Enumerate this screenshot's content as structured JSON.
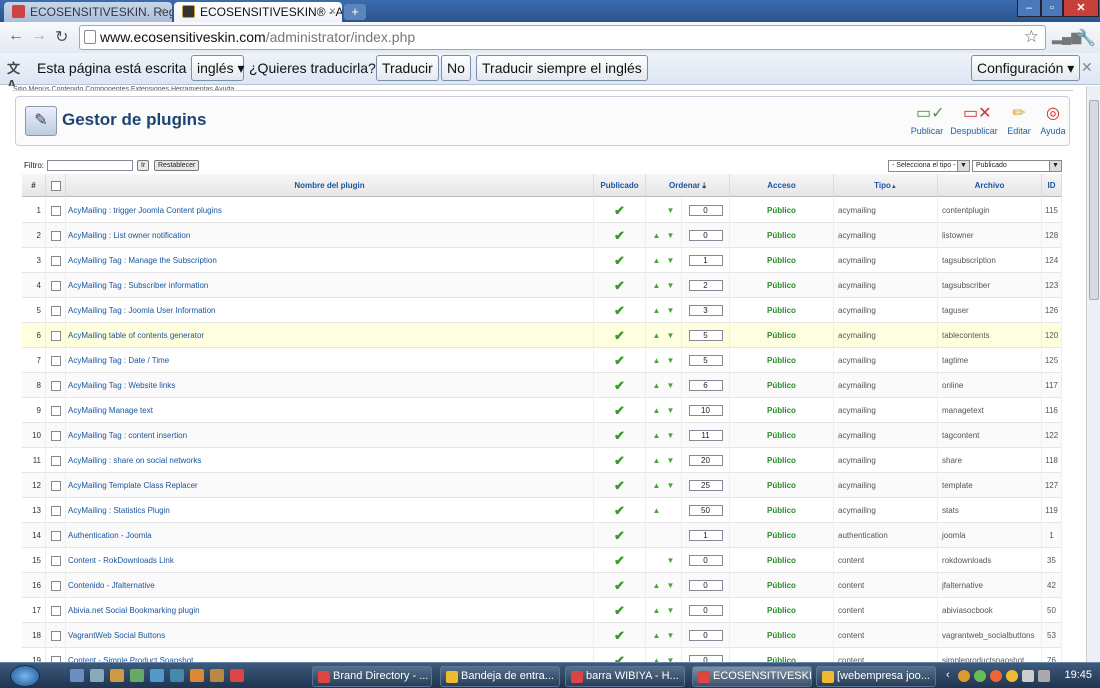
{
  "browser": {
    "tabs": [
      {
        "title": "ECOSENSITIVESKIN. Regalo",
        "active": false
      },
      {
        "title": "ECOSENSITIVESKIN® - Adm",
        "active": true
      }
    ],
    "new_tab": "+",
    "url_host": "www.ecosensitiveskin.com",
    "url_path": "/administrator/index.php"
  },
  "translate_bar": {
    "text_before": "Esta página está escrita en",
    "language": "inglés",
    "question": "¿Quieres traducirla?",
    "translate_btn": "Traducir",
    "no_btn": "No",
    "always_btn": "Traducir siempre el inglés",
    "config_btn": "Configuración"
  },
  "admin": {
    "top_menu": "Sitio   Menús   Contenido   Componentes   Extensiones   Herramientas   Ayuda",
    "page_title": "Gestor de plugins",
    "toolbar": [
      {
        "label": "Publicar",
        "icon": "publish-icon"
      },
      {
        "label": "Despublicar",
        "icon": "unpublish-icon"
      },
      {
        "label": "Editar",
        "icon": "edit-icon"
      },
      {
        "label": "Ayuda",
        "icon": "help-icon"
      }
    ],
    "filter_label": "Filtro:",
    "filter_value": "",
    "go_btn": "Ir",
    "reset_btn": "Restablecer",
    "type_select": "- Selecciona el tipo -",
    "state_select": "Publicado"
  },
  "table": {
    "headers": {
      "num": "#",
      "name": "Nombre del plugin",
      "published": "Publicado",
      "order": "Ordenar",
      "access": "Acceso",
      "type": "Tipo",
      "file": "Archivo",
      "id": "ID"
    },
    "rows": [
      {
        "n": "1",
        "name": "AcyMailing : trigger Joomla Content plugins",
        "up": false,
        "down": true,
        "order": "0",
        "access": "Público",
        "type": "acymailing",
        "file": "contentplugin",
        "id": "115"
      },
      {
        "n": "2",
        "name": "AcyMailing : List owner notification",
        "up": true,
        "down": true,
        "order": "0",
        "access": "Público",
        "type": "acymailing",
        "file": "listowner",
        "id": "128"
      },
      {
        "n": "3",
        "name": "AcyMailing Tag : Manage the Subscription",
        "up": true,
        "down": true,
        "order": "1",
        "access": "Público",
        "type": "acymailing",
        "file": "tagsubscription",
        "id": "124"
      },
      {
        "n": "4",
        "name": "AcyMailing Tag : Subscriber information",
        "up": true,
        "down": true,
        "order": "2",
        "access": "Público",
        "type": "acymailing",
        "file": "tagsubscriber",
        "id": "123"
      },
      {
        "n": "5",
        "name": "AcyMailing Tag : Joomla User Information",
        "up": true,
        "down": true,
        "order": "3",
        "access": "Público",
        "type": "acymailing",
        "file": "taguser",
        "id": "126"
      },
      {
        "n": "6",
        "name": "AcyMailing table of contents generator",
        "up": true,
        "down": true,
        "order": "5",
        "access": "Público",
        "type": "acymailing",
        "file": "tablecontents",
        "id": "120"
      },
      {
        "n": "7",
        "name": "AcyMailing Tag : Date / Time",
        "up": true,
        "down": true,
        "order": "5",
        "access": "Público",
        "type": "acymailing",
        "file": "tagtime",
        "id": "125"
      },
      {
        "n": "8",
        "name": "AcyMailing Tag : Website links",
        "up": true,
        "down": true,
        "order": "6",
        "access": "Público",
        "type": "acymailing",
        "file": "online",
        "id": "117"
      },
      {
        "n": "9",
        "name": "AcyMailing Manage text",
        "up": true,
        "down": true,
        "order": "10",
        "access": "Público",
        "type": "acymailing",
        "file": "managetext",
        "id": "116"
      },
      {
        "n": "10",
        "name": "AcyMailing Tag : content insertion",
        "up": true,
        "down": true,
        "order": "11",
        "access": "Público",
        "type": "acymailing",
        "file": "tagcontent",
        "id": "122"
      },
      {
        "n": "11",
        "name": "AcyMailing : share on social networks",
        "up": true,
        "down": true,
        "order": "20",
        "access": "Público",
        "type": "acymailing",
        "file": "share",
        "id": "118"
      },
      {
        "n": "12",
        "name": "AcyMailing Template Class Replacer",
        "up": true,
        "down": true,
        "order": "25",
        "access": "Público",
        "type": "acymailing",
        "file": "template",
        "id": "127"
      },
      {
        "n": "13",
        "name": "AcyMailing : Statistics Plugin",
        "up": true,
        "down": false,
        "order": "50",
        "access": "Público",
        "type": "acymailing",
        "file": "stats",
        "id": "119"
      },
      {
        "n": "14",
        "name": "Authentication - Joomla",
        "up": false,
        "down": false,
        "order": "1",
        "access": "Público",
        "type": "authentication",
        "file": "joomla",
        "id": "1"
      },
      {
        "n": "15",
        "name": "Content - RokDownloads Link",
        "up": false,
        "down": true,
        "order": "0",
        "access": "Público",
        "type": "content",
        "file": "rokdownloads",
        "id": "35"
      },
      {
        "n": "16",
        "name": "Contenido - Jfalternative",
        "up": true,
        "down": true,
        "order": "0",
        "access": "Público",
        "type": "content",
        "file": "jfalternative",
        "id": "42"
      },
      {
        "n": "17",
        "name": "Abivia.net Social Bookmarking plugin",
        "up": true,
        "down": true,
        "order": "0",
        "access": "Público",
        "type": "content",
        "file": "abiviasocbook",
        "id": "50"
      },
      {
        "n": "18",
        "name": "VagrantWeb Social Buttons",
        "up": true,
        "down": true,
        "order": "0",
        "access": "Público",
        "type": "content",
        "file": "vagrantweb_socialbuttons",
        "id": "53"
      },
      {
        "n": "19",
        "name": "Content - Simple Product Snapshot",
        "up": true,
        "down": true,
        "order": "0",
        "access": "Público",
        "type": "content",
        "file": "simpleproductsnapshot",
        "id": "76"
      }
    ]
  },
  "taskbar": {
    "tasks": [
      {
        "label": "Brand Directory - ...",
        "active": false
      },
      {
        "label": "Bandeja de entra...",
        "active": false
      },
      {
        "label": "barra WIBIYA - H...",
        "active": false
      },
      {
        "label": "ECOSENSITIVESKI...",
        "active": true
      },
      {
        "label": "[webempresa joo...",
        "active": false
      }
    ],
    "clock": "19:45"
  }
}
